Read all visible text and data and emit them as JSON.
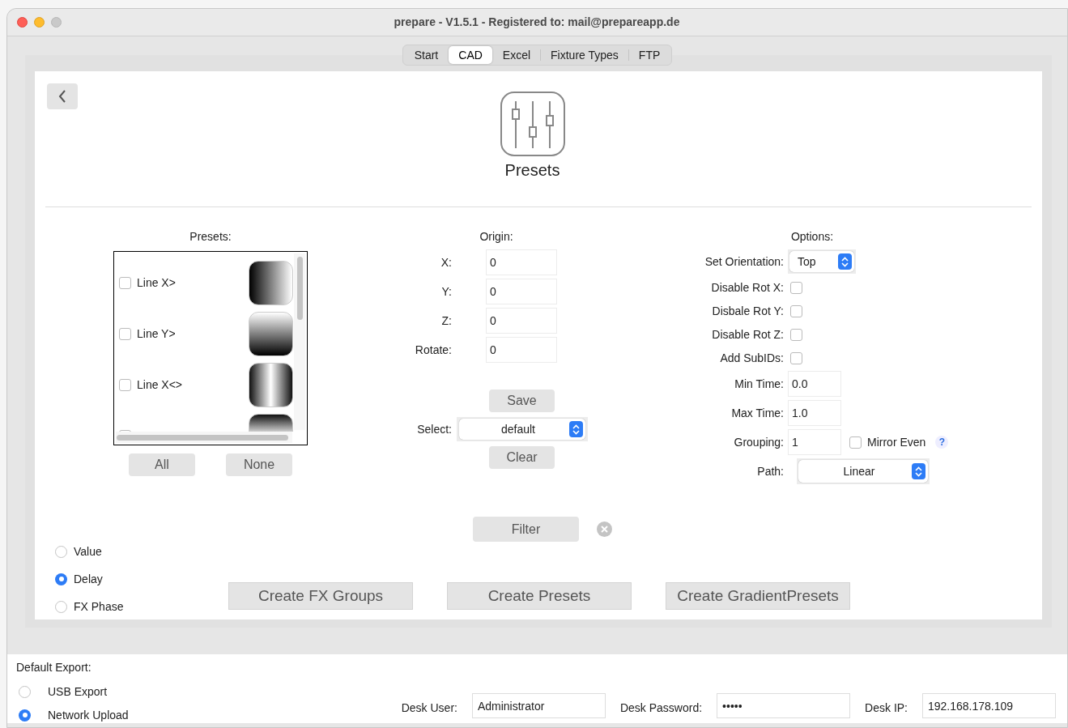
{
  "window": {
    "title": "prepare - V1.5.1 -  Registered to: mail@prepareapp.de"
  },
  "tabs": [
    {
      "label": "Start",
      "selected": false
    },
    {
      "label": "CAD",
      "selected": true
    },
    {
      "label": "Excel",
      "selected": false
    },
    {
      "label": "Fixture Types",
      "selected": false
    },
    {
      "label": "FTP",
      "selected": false
    }
  ],
  "page_title": "Presets",
  "presets": {
    "heading": "Presets:",
    "items": [
      {
        "label": "Line X>",
        "checked": false,
        "kind": "x"
      },
      {
        "label": "Line Y>",
        "checked": false,
        "kind": "y"
      },
      {
        "label": "Line X<>",
        "checked": false,
        "kind": "x_mirror"
      },
      {
        "checked": false,
        "kind": "y_mirror"
      }
    ],
    "buttons": [
      "All",
      "None"
    ]
  },
  "origin": {
    "heading": "Origin:",
    "fields": [
      {
        "label": "X:",
        "value": "0"
      },
      {
        "label": "Y:",
        "value": "0"
      },
      {
        "label": "Z:",
        "value": "0"
      },
      {
        "label": "Rotate:",
        "value": "0"
      }
    ],
    "save": "Save",
    "select": {
      "label": "Select:",
      "value": "default"
    },
    "clear": "Clear"
  },
  "options": {
    "heading": "Options:",
    "orientation": {
      "label": "Set Orientation:",
      "value": "Top"
    },
    "checks": [
      {
        "label": "Disable Rot X:",
        "checked": false
      },
      {
        "label": "Disbale Rot Y:",
        "checked": false
      },
      {
        "label": "Disable Rot Z:",
        "checked": false
      },
      {
        "label": "Add SubIDs:",
        "checked": false
      }
    ],
    "times": [
      {
        "label": "Min Time:",
        "value": "0.0"
      },
      {
        "label": "Max Time:",
        "value": "1.0"
      }
    ],
    "grouping": {
      "label": "Grouping:",
      "value": "1"
    },
    "mirror": {
      "label": "Mirror Even",
      "checked": false
    },
    "help": "?",
    "path": {
      "label": "Path:",
      "value": "Linear"
    }
  },
  "filter": "Filter",
  "modes": [
    {
      "label": "Value",
      "selected": false
    },
    {
      "label": "Delay",
      "selected": true
    },
    {
      "label": "FX Phase",
      "selected": false
    }
  ],
  "actions": [
    "Create FX Groups",
    "Create Presets",
    "Create GradientPresets"
  ],
  "export": {
    "heading": "Default Export:",
    "options": [
      {
        "label": "USB Export",
        "selected": false
      },
      {
        "label": "Network Upload",
        "selected": true
      }
    ],
    "fields": [
      {
        "label": "Desk User:",
        "value": "Administrator"
      },
      {
        "label": "Desk Password:",
        "value": "•••••"
      },
      {
        "label": "Desk IP:",
        "value": "192.168.178.109"
      }
    ]
  }
}
